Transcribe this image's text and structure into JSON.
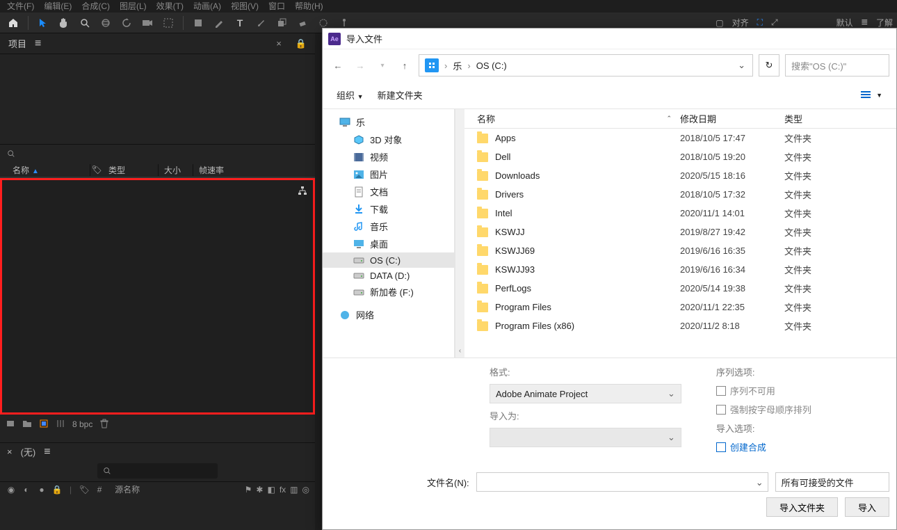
{
  "ae_menu": [
    "文件(F)",
    "编辑(E)",
    "合成(C)",
    "图层(L)",
    "效果(T)",
    "动画(A)",
    "视图(V)",
    "窗口",
    "帮助(H)"
  ],
  "ae_right": {
    "align": "对齐",
    "default": "默认",
    "learn": "了解"
  },
  "project": {
    "title": "项目",
    "search_placeholder": "",
    "cols": {
      "name": "名称",
      "type": "类型",
      "size": "大小",
      "fps": "帧速率"
    },
    "bpc": "8 bpc"
  },
  "comp": {
    "none": "(无)",
    "src": "源名称"
  },
  "dialog": {
    "title": "导入文件",
    "breadcrumb": {
      "root": "乐",
      "drive": "OS (C:)"
    },
    "search_placeholder": "搜索\"OS (C:)\"",
    "organize": "组织",
    "newfolder": "新建文件夹",
    "tree_top": "乐",
    "tree": [
      {
        "label": "3D 对象",
        "icon": "cube"
      },
      {
        "label": "视频",
        "icon": "film"
      },
      {
        "label": "图片",
        "icon": "image"
      },
      {
        "label": "文档",
        "icon": "doc"
      },
      {
        "label": "下载",
        "icon": "download"
      },
      {
        "label": "音乐",
        "icon": "music"
      },
      {
        "label": "桌面",
        "icon": "desktop"
      },
      {
        "label": "OS (C:)",
        "icon": "drive",
        "selected": true
      },
      {
        "label": "DATA (D:)",
        "icon": "drive"
      },
      {
        "label": "新加卷 (F:)",
        "icon": "drive"
      }
    ],
    "tree_net": "网络",
    "cols": {
      "name": "名称",
      "date": "修改日期",
      "type": "类型"
    },
    "files": [
      {
        "name": "Apps",
        "date": "2018/10/5 17:47",
        "type": "文件夹"
      },
      {
        "name": "Dell",
        "date": "2018/10/5 19:20",
        "type": "文件夹"
      },
      {
        "name": "Downloads",
        "date": "2020/5/15 18:16",
        "type": "文件夹"
      },
      {
        "name": "Drivers",
        "date": "2018/10/5 17:32",
        "type": "文件夹"
      },
      {
        "name": "Intel",
        "date": "2020/11/1 14:01",
        "type": "文件夹"
      },
      {
        "name": "KSWJJ",
        "date": "2019/8/27 19:42",
        "type": "文件夹"
      },
      {
        "name": "KSWJJ69",
        "date": "2019/6/16 16:35",
        "type": "文件夹"
      },
      {
        "name": "KSWJJ93",
        "date": "2019/6/16 16:34",
        "type": "文件夹"
      },
      {
        "name": "PerfLogs",
        "date": "2020/5/14 19:38",
        "type": "文件夹"
      },
      {
        "name": "Program Files",
        "date": "2020/11/1 22:35",
        "type": "文件夹"
      },
      {
        "name": "Program Files (x86)",
        "date": "2020/11/2 8:18",
        "type": "文件夹"
      }
    ],
    "opts": {
      "format_label": "格式:",
      "format_value": "Adobe Animate Project",
      "import_as_label": "导入为:",
      "seq_label": "序列选项:",
      "seq_na": "序列不可用",
      "force_alpha": "强制按字母顺序排列",
      "import_opts_label": "导入选项:",
      "create_comp": "创建合成"
    },
    "filename_label": "文件名(N):",
    "filter": "所有可接受的文件",
    "btn_import_folder": "导入文件夹",
    "btn_import": "导入"
  }
}
